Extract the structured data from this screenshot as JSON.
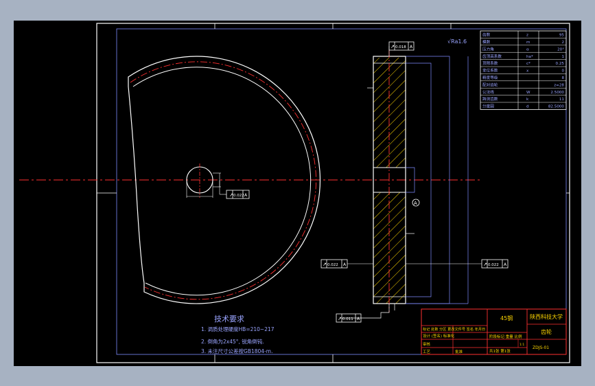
{
  "colors": {
    "chrome": "#a7b2c2",
    "canvas": "#000000",
    "linework": "#ffffff",
    "accent": "#7f8cff",
    "centerline": "#ff3030",
    "hatch": "#ffd700",
    "notes": "#9aa4ff"
  },
  "drawing": {
    "surface_finish": "√Ra1.6",
    "tolerances": {
      "bore_runout": "0.022",
      "face_runout_top": "0.018",
      "face_runout_left": "0.022",
      "face_runout_right": "0.022",
      "tooth_runout": "0.011"
    },
    "technical_requirements": {
      "title": "技术要求",
      "items": [
        "1. 调质处理硬度HB=210~217",
        "2. 倒角为2x45°, 锐角倒钝.",
        "3. 未注尺寸公差按GB1804-m."
      ]
    },
    "gear_table": {
      "rows": [
        {
          "param": "齿数",
          "sym": "z",
          "val": "95"
        },
        {
          "param": "模数",
          "sym": "m",
          "val": "2"
        },
        {
          "param": "压力角",
          "sym": "α",
          "val": "20°"
        },
        {
          "param": "齿顶高系数",
          "sym": "ha*",
          "val": "1"
        },
        {
          "param": "顶隙系数",
          "sym": "c*",
          "val": "0.25"
        },
        {
          "param": "变位系数",
          "sym": "x",
          "val": "0"
        },
        {
          "param": "精度等级",
          "sym": "",
          "val": "8"
        },
        {
          "param": "配对齿轮",
          "sym": "",
          "val": "z=28"
        },
        {
          "param": "公法线",
          "sym": "W",
          "val": "2.5000"
        },
        {
          "param": "跨测齿数",
          "sym": "k",
          "val": "11"
        },
        {
          "param": "分度圆",
          "sym": "d",
          "val": "82.5000"
        }
      ]
    },
    "title_block": {
      "material": "45钢",
      "school": "陕西科技大学",
      "part_name": "齿轮",
      "drawing_no": "ZDJS-01",
      "header_row": "标记 处数 分区 更改文件号 签名 年月日",
      "designer_row": "设计 (签名)   标准化",
      "stage_row": "阶段标记  重量  比例",
      "reviewer": "审核",
      "craft": "工艺",
      "approve": "批准",
      "scale": "1:1",
      "sheet": "共1张  第1张"
    }
  }
}
